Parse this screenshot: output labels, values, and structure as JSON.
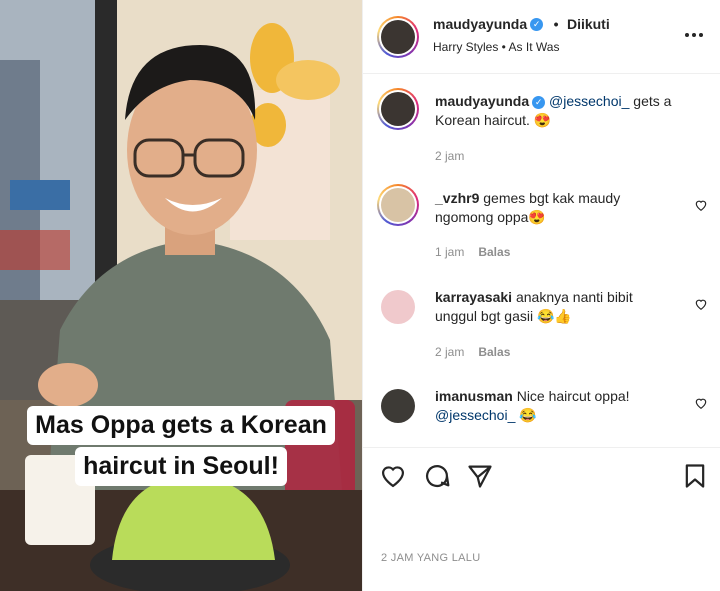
{
  "post": {
    "caption_overlay_line1": "Mas Oppa gets a Korean",
    "caption_overlay_line2": "haircut in Seoul!"
  },
  "header": {
    "username": "maudyayunda",
    "separator": "•",
    "follow_status": "Diikuti",
    "music": "Harry Styles • As It Was",
    "more_icon": "more-horizontal-icon"
  },
  "caption": {
    "username": "maudyayunda",
    "mention": "@jessechoi_",
    "text": " gets a Korean haircut. 😍",
    "time": "2 jam"
  },
  "comments": [
    {
      "username": "_vzhr9",
      "text_line1": "gemes bgt kak maudy",
      "text_line2": "ngomong oppa😍",
      "time": "1 jam",
      "reply": "Balas"
    },
    {
      "username": "karrayasaki",
      "text_line1": "anaknya nanti bibit",
      "text_line2": "unggul bgt gasii 😂👍",
      "time": "2 jam",
      "reply": "Balas"
    },
    {
      "username": "imanusman",
      "text_line1": "Nice haircut oppa!",
      "mention": "@jessechoi_",
      "emoji": "😂"
    }
  ],
  "actions": {
    "like_icon": "heart-icon",
    "comment_icon": "comment-icon",
    "share_icon": "send-icon",
    "save_icon": "bookmark-icon",
    "timestamp": "2 JAM YANG LALU"
  },
  "colors": {
    "verified": "#3897f0",
    "mention": "#00376b",
    "muted": "#8e8e8e"
  }
}
